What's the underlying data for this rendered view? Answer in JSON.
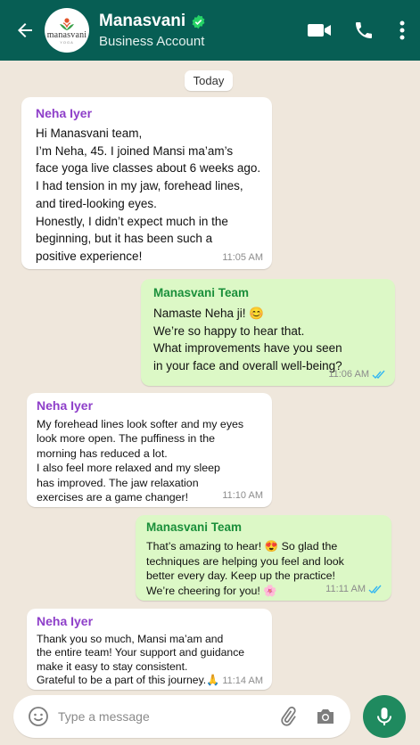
{
  "header": {
    "title": "Manasvani",
    "subtitle": "Business Account",
    "avatar_text": "manasvani",
    "avatar_subtext": "YOGA",
    "icons": [
      "back-arrow-icon",
      "verified-icon",
      "video-call-icon",
      "phone-icon",
      "more-vert-icon"
    ]
  },
  "date_chip": "Today",
  "messages": [
    {
      "direction": "incoming",
      "sender": "Neha Iyer",
      "text": "Hi Manasvani team,\nI’m Neha, 45. I joined Mansi ma’am’s\nface yoga live classes about 6 weeks ago.\nI had tension in my jaw, forehead lines,\nand tired-looking eyes.\nHonestly, I didn’t expect much in the\nbeginning, but it has been such a\npositive experience!",
      "time": "11:05 AM"
    },
    {
      "direction": "outgoing",
      "sender": "Manasvani Team",
      "text": "Namaste Neha ji! 😊\nWe’re so happy to hear that.\nWhat improvements have you seen\nin your face and overall well-being?",
      "time": "11:06 AM"
    },
    {
      "direction": "incoming",
      "sender": "Neha Iyer",
      "text": "My forehead lines look softer and my eyes\nlook more open. The puffiness in the\nmorning has reduced a lot.\nI also feel more relaxed and my sleep\nhas improved. The jaw relaxation\nexercises are a game changer!",
      "time": "11:10 AM"
    },
    {
      "direction": "outgoing",
      "sender": "Manasvani Team",
      "text": "That’s amazing to hear! 😍 So glad the\ntechniques are helping you feel and look\nbetter every day. Keep up the practice!\nWe’re cheering for you! 🌸",
      "time": "11:11 AM"
    },
    {
      "direction": "incoming",
      "sender": "Neha Iyer",
      "text": "Thank you so much, Mansi ma’am and\nthe entire team! Your support and guidance\nmake it easy to stay consistent.\nGrateful to be a part of this journey.🙏",
      "time": "11:14 AM"
    }
  ],
  "composer": {
    "placeholder": "Type a message",
    "icons": [
      "emoji-icon",
      "attach-icon",
      "camera-icon",
      "mic-icon"
    ]
  },
  "colors": {
    "header_bg": "#075e54",
    "chat_bg": "#efe7dc",
    "incoming_bubble": "#ffffff",
    "outgoing_bubble": "#dcf8c6",
    "sender_incoming": "#8e3fc9",
    "sender_outgoing": "#1a8f3a",
    "read_ticks": "#34b7f1",
    "mic_button": "#1f8a5f"
  }
}
